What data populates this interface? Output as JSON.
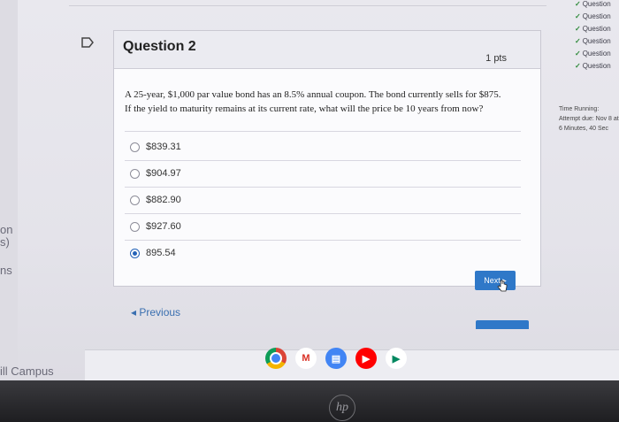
{
  "question": {
    "title": "Question 2",
    "points": "1 pts",
    "text_line1": "A 25-year, $1,000 par value bond has an 8.5% annual coupon. The bond currently sells for $875.",
    "text_line2": "If the yield to maturity remains at its current rate, what will the price be 10 years from now?",
    "answers": [
      {
        "label": "$839.31",
        "selected": false
      },
      {
        "label": "$904.97",
        "selected": false
      },
      {
        "label": "$882.90",
        "selected": false
      },
      {
        "label": "$927.60",
        "selected": false
      },
      {
        "label": "895.54",
        "selected": true
      }
    ]
  },
  "nav": {
    "next_label": "Next ▸",
    "previous_label": "◂ Previous"
  },
  "sidebar": {
    "items": [
      "Question",
      "Question",
      "Question",
      "Question",
      "Question",
      "Question"
    ],
    "time_label": "Time Running:",
    "attempt_line": "Attempt due: Nov 8 at",
    "time_value": "6 Minutes, 40 Sec"
  },
  "edge": {
    "left_text1": "on",
    "left_text2": "s)",
    "left_text3": "ns",
    "campus": "ill Campus"
  },
  "taskbar": {
    "icons": [
      "chrome-icon",
      "gmail-icon",
      "docs-icon",
      "youtube-icon",
      "play-store-icon"
    ],
    "hp_logo": "hp"
  },
  "colors": {
    "accent": "#2f78c8",
    "selected_radio": "#2463b8"
  }
}
